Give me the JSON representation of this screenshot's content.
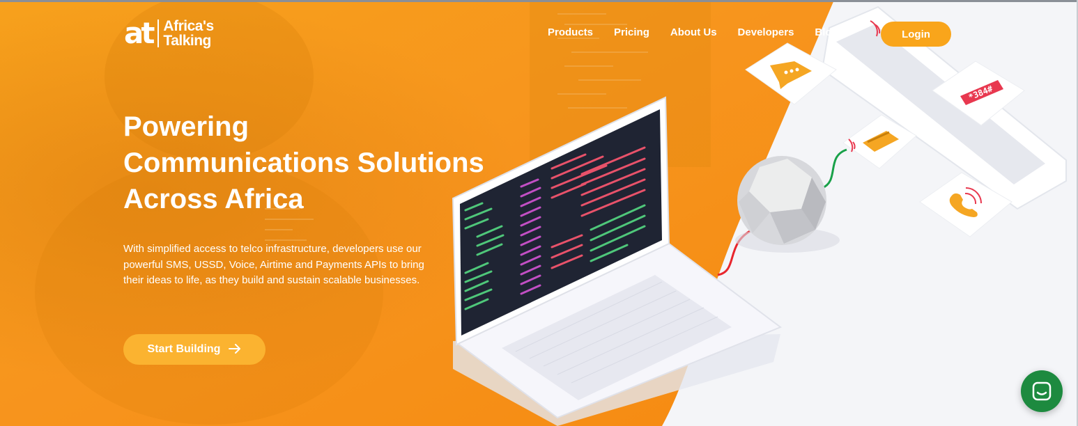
{
  "brand": {
    "mark": "at",
    "name_line1": "Africa's",
    "name_line2": "Talking"
  },
  "nav": {
    "items": [
      {
        "label": "Products"
      },
      {
        "label": "Pricing"
      },
      {
        "label": "About Us"
      },
      {
        "label": "Developers"
      },
      {
        "label": "Blog"
      }
    ],
    "login_label": "Login"
  },
  "hero": {
    "title_lines": [
      "Powering",
      "Communications Solutions",
      "Across Africa"
    ],
    "description": "With simplified access to telco infrastructure, developers use our powerful SMS, USSD, Voice, Airtime and Payments APIs to bring their ideas to life, as they build and sustain scalable businesses.",
    "cta_label": "Start Building",
    "cta_icon": "arrow-right-icon"
  },
  "illustration": {
    "ussd_code": "*384#",
    "icons": [
      "chat-bubble-icon",
      "ussd-icon",
      "card-payment-icon",
      "phone-call-icon",
      "router-sphere-icon",
      "laptop-icon"
    ]
  },
  "chat": {
    "icon": "chat-icon"
  },
  "colors": {
    "orange": "#f7941d",
    "button_yellow": "#f9a51b",
    "chat_green": "#1d8a3f",
    "ussd_red": "#e8384f"
  }
}
